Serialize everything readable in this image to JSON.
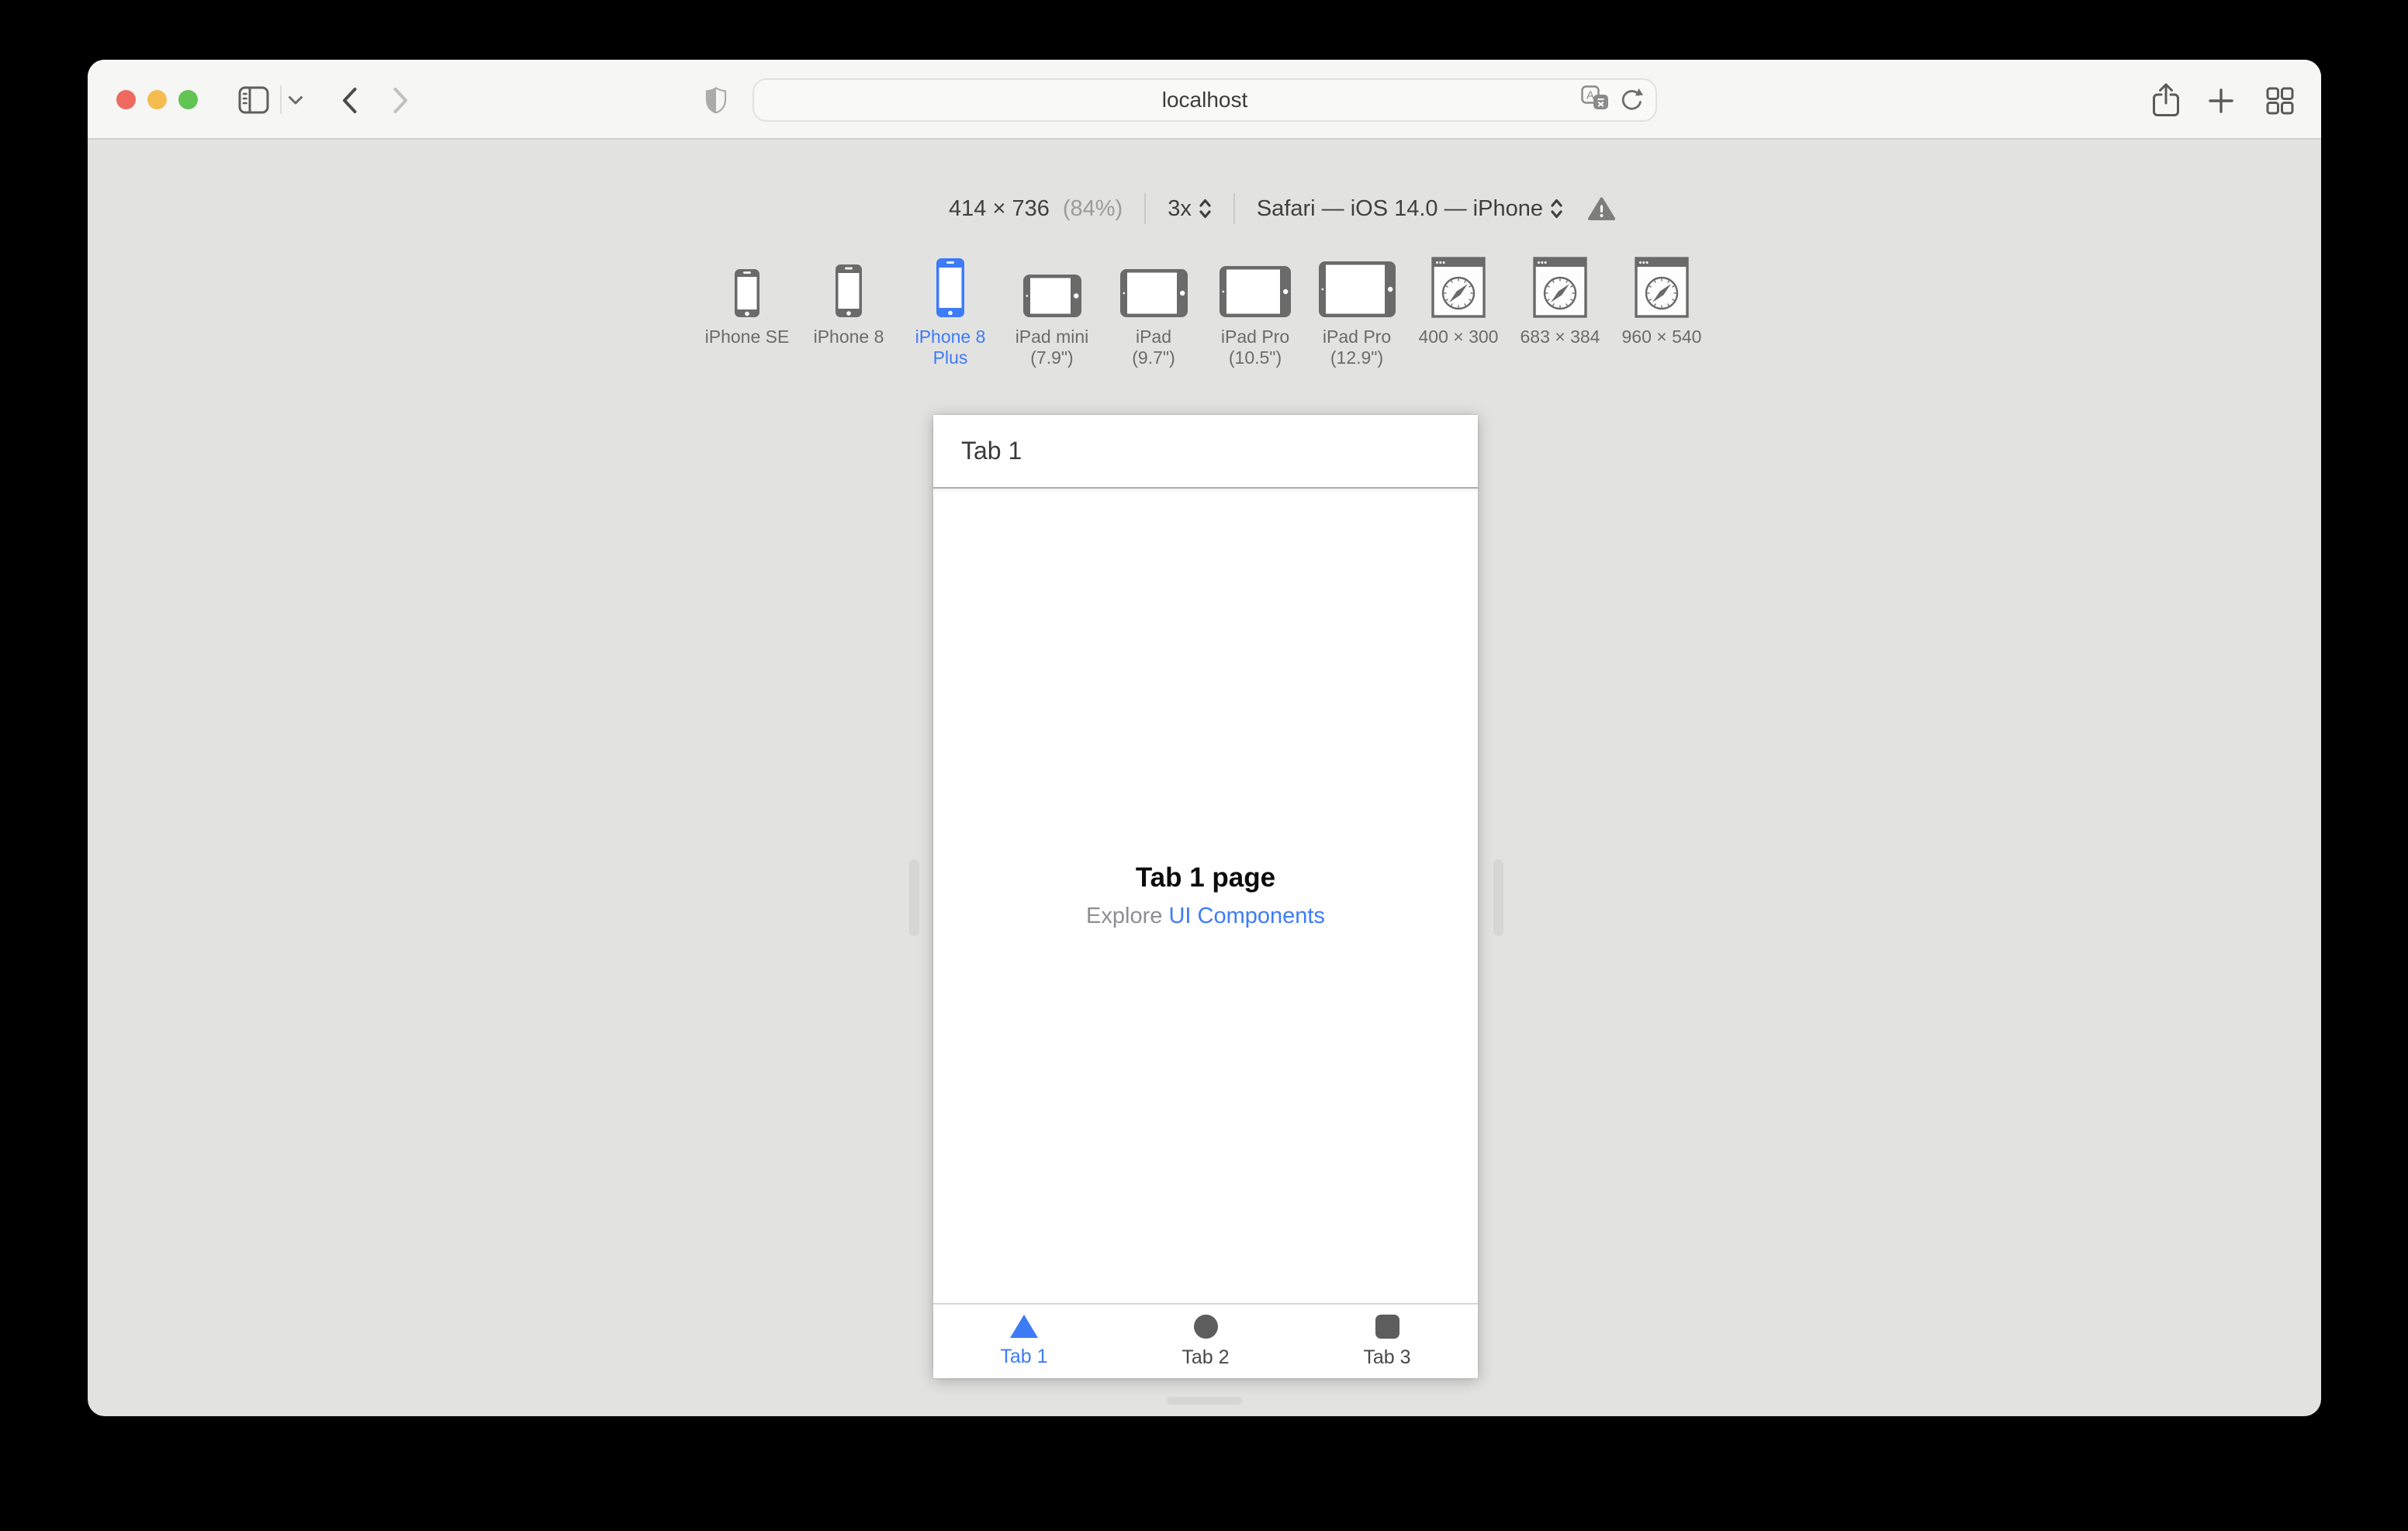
{
  "toolbar": {
    "url": "localhost",
    "window_controls": [
      "close",
      "minimize",
      "zoom"
    ],
    "icons": {
      "left": [
        "sidebar-toggle",
        "chevron-down",
        "back",
        "forward"
      ],
      "address": [
        "privacy-shield",
        "translate",
        "reload"
      ],
      "right": [
        "share",
        "new-tab",
        "tab-overview"
      ]
    }
  },
  "rdm": {
    "dimensions": "414 × 736",
    "zoom": "(84%)",
    "scale_factor": "3x",
    "user_agent": "Safari — iOS 14.0 — iPhone",
    "warning_icon": "warning-triangle",
    "devices": [
      {
        "id": "iphone-se",
        "label": "iPhone SE",
        "sublabel": "",
        "type": "phone",
        "selected": false
      },
      {
        "id": "iphone-8",
        "label": "iPhone 8",
        "sublabel": "",
        "type": "phone",
        "selected": false
      },
      {
        "id": "iphone-8-plus",
        "label": "iPhone 8",
        "sublabel": "Plus",
        "type": "phone",
        "selected": true
      },
      {
        "id": "ipad-mini",
        "label": "iPad mini",
        "sublabel": "(7.9\")",
        "type": "tablet",
        "selected": false
      },
      {
        "id": "ipad",
        "label": "iPad",
        "sublabel": "(9.7\")",
        "type": "tablet",
        "selected": false
      },
      {
        "id": "ipad-pro-10-5",
        "label": "iPad Pro",
        "sublabel": "(10.5\")",
        "type": "tablet",
        "selected": false
      },
      {
        "id": "ipad-pro-12-9",
        "label": "iPad Pro",
        "sublabel": "(12.9\")",
        "type": "tablet",
        "selected": false
      },
      {
        "id": "custom-400x300",
        "label": "400 × 300",
        "sublabel": "",
        "type": "browser",
        "selected": false
      },
      {
        "id": "custom-683x384",
        "label": "683 × 384",
        "sublabel": "",
        "type": "browser",
        "selected": false
      },
      {
        "id": "custom-960x540",
        "label": "960 × 540",
        "sublabel": "",
        "type": "browser",
        "selected": false
      }
    ]
  },
  "preview": {
    "nav_title": "Tab 1",
    "page_title": "Tab 1 page",
    "explore_prefix": "Explore",
    "explore_link": "UI Components",
    "tabs": [
      {
        "label": "Tab 1",
        "icon": "triangle",
        "active": true
      },
      {
        "label": "Tab 2",
        "icon": "circle",
        "active": false
      },
      {
        "label": "Tab 3",
        "icon": "square",
        "active": false
      }
    ]
  },
  "colors": {
    "accent_blue": "#3D7BF7",
    "traffic_lights": [
      "#EE6A5F",
      "#F5BD4F",
      "#61C454"
    ],
    "device_icon_gray": "#6a6a6a",
    "tab_inactive_icon": "#5d5d5d",
    "warning_gray": "#7d7d7d",
    "toolbar_bg": "#f6f6f5",
    "canvas_bg": "#e2e2e1"
  }
}
